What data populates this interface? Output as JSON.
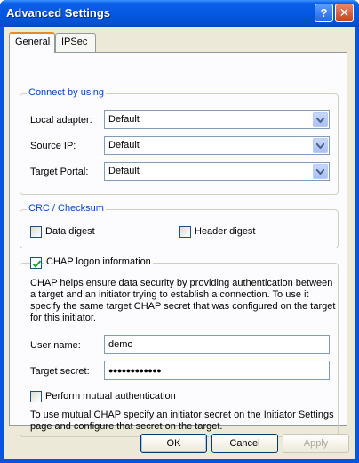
{
  "window": {
    "title": "Advanced Settings",
    "help_glyph": "?",
    "close_glyph": "✕"
  },
  "tabs": [
    {
      "label": "General",
      "selected": true
    },
    {
      "label": "IPSec",
      "selected": false
    }
  ],
  "connect_group": {
    "legend": "Connect by using",
    "local_adapter": {
      "label": "Local adapter:",
      "value": "Default"
    },
    "source_ip": {
      "label": "Source IP:",
      "value": "Default"
    },
    "target_portal": {
      "label": "Target Portal:",
      "value": "Default"
    }
  },
  "crc_group": {
    "legend": "CRC / Checksum",
    "data_digest": {
      "label": "Data digest",
      "checked": false
    },
    "header_digest": {
      "label": "Header digest",
      "checked": false
    }
  },
  "chap_group": {
    "checkbox_label": "CHAP logon information",
    "checked": true,
    "description": "CHAP helps ensure data security by providing authentication between a target and an initiator trying to establish a connection. To use it specify the same target CHAP secret that was configured on the target for this initiator.",
    "user_name": {
      "label": "User name:",
      "value": "demo"
    },
    "target_secret": {
      "label": "Target secret:",
      "value": "●●●●●●●●●●●●"
    },
    "mutual": {
      "label": "Perform mutual authentication",
      "checked": false
    },
    "mutual_description": "To use mutual CHAP specify an initiator secret on the Initiator Settings page and configure that secret on the target."
  },
  "buttons": {
    "ok": "OK",
    "cancel": "Cancel",
    "apply": "Apply"
  },
  "colors": {
    "titlebar": "#0458e2",
    "legend": "#0046d5",
    "dialog_bg": "#ece9d8",
    "panel_bg": "#fcfcfe"
  }
}
